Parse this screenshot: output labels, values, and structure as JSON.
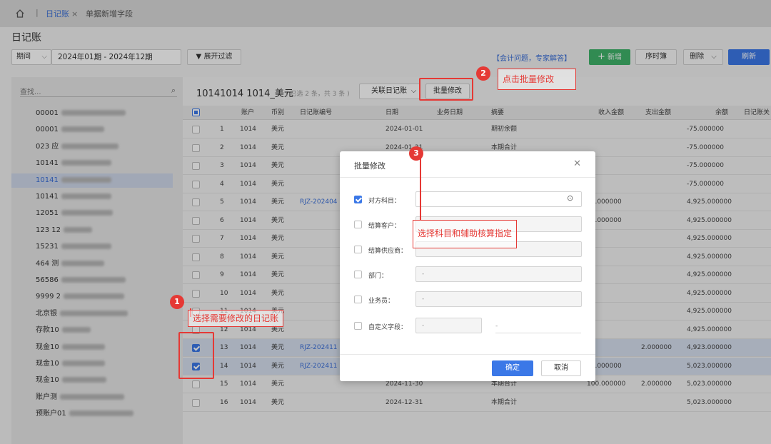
{
  "tabs": {
    "active": "日记账",
    "close": "×",
    "other": "单据新增字段"
  },
  "page_title": "日记账",
  "filter": {
    "period_label": "期间",
    "period_range": "2024年01期 - 2024年12期",
    "expand_filter": "展开过滤"
  },
  "toolbar": {
    "help_link": "【会计问题，专家解答】",
    "add": "新增",
    "sequence": "序时簿",
    "delete": "删除",
    "refresh": "刷新"
  },
  "sidebar": {
    "search_placeholder": "查找...",
    "items": [
      "00001",
      "00001",
      "023 应",
      "10141",
      "10141",
      "10141",
      "12051",
      "123 12",
      "15231",
      "464 测",
      "56586",
      "9999 2",
      "北京银",
      "存款10",
      "现金10",
      "现金10",
      "现金10",
      "账户测",
      "预账户01"
    ]
  },
  "account": {
    "title": "10141014 1014_美元",
    "selection_info": "( 已选 2 条，共 3 条 )",
    "related_journal": "关联日记账",
    "batch_edit": "批量修改"
  },
  "table": {
    "headers": [
      "账户",
      "币别",
      "日记账编号",
      "日期",
      "业务日期",
      "摘要",
      "收入金额",
      "支出金额",
      "余额",
      "日记账关"
    ],
    "rows": [
      {
        "n": "1",
        "acct": "1014",
        "cur": "美元",
        "no": "",
        "date": "2024-01-01",
        "bdate": "",
        "memo": "期初余额",
        "income": "",
        "expense": "",
        "balance": "-75.000000",
        "checked": false
      },
      {
        "n": "2",
        "acct": "1014",
        "cur": "美元",
        "no": "",
        "date": "2024-01-31",
        "bdate": "",
        "memo": "本期合计",
        "income": "",
        "expense": "",
        "balance": "-75.000000",
        "checked": false
      },
      {
        "n": "3",
        "acct": "1014",
        "cur": "美元",
        "no": "",
        "date": "",
        "bdate": "",
        "memo": "",
        "income": "",
        "expense": "",
        "balance": "-75.000000",
        "checked": false
      },
      {
        "n": "4",
        "acct": "1014",
        "cur": "美元",
        "no": "",
        "date": "",
        "bdate": "",
        "memo": "",
        "income": "",
        "expense": "",
        "balance": "-75.000000",
        "checked": false
      },
      {
        "n": "5",
        "acct": "1014",
        "cur": "美元",
        "no": "RJZ-202404",
        "date": "",
        "bdate": "",
        "memo": "",
        "income": "00.000000",
        "expense": "",
        "balance": "4,925.000000",
        "checked": false
      },
      {
        "n": "6",
        "acct": "1014",
        "cur": "美元",
        "no": "",
        "date": "",
        "bdate": "",
        "memo": "",
        "income": "00.000000",
        "expense": "",
        "balance": "4,925.000000",
        "checked": false
      },
      {
        "n": "7",
        "acct": "1014",
        "cur": "美元",
        "no": "",
        "date": "",
        "bdate": "",
        "memo": "",
        "income": "",
        "expense": "",
        "balance": "4,925.000000",
        "checked": false
      },
      {
        "n": "8",
        "acct": "1014",
        "cur": "美元",
        "no": "",
        "date": "",
        "bdate": "",
        "memo": "",
        "income": "",
        "expense": "",
        "balance": "4,925.000000",
        "checked": false
      },
      {
        "n": "9",
        "acct": "1014",
        "cur": "美元",
        "no": "",
        "date": "",
        "bdate": "",
        "memo": "",
        "income": "",
        "expense": "",
        "balance": "4,925.000000",
        "checked": false
      },
      {
        "n": "10",
        "acct": "1014",
        "cur": "美元",
        "no": "",
        "date": "",
        "bdate": "",
        "memo": "",
        "income": "",
        "expense": "",
        "balance": "4,925.000000",
        "checked": false
      },
      {
        "n": "11",
        "acct": "1014",
        "cur": "美元",
        "no": "",
        "date": "",
        "bdate": "",
        "memo": "",
        "income": "",
        "expense": "",
        "balance": "4,925.000000",
        "checked": false
      },
      {
        "n": "12",
        "acct": "1014",
        "cur": "美元",
        "no": "",
        "date": "",
        "bdate": "",
        "memo": "",
        "income": "",
        "expense": "",
        "balance": "4,925.000000",
        "checked": false
      },
      {
        "n": "13",
        "acct": "1014",
        "cur": "美元",
        "no": "RJZ-202411",
        "date": "",
        "bdate": "",
        "memo": "",
        "income": "",
        "expense": "2.000000",
        "balance": "4,923.000000",
        "checked": true
      },
      {
        "n": "14",
        "acct": "1014",
        "cur": "美元",
        "no": "RJZ-202411",
        "date": "",
        "bdate": "",
        "memo": "",
        "income": "00.000000",
        "expense": "",
        "balance": "5,023.000000",
        "checked": true
      },
      {
        "n": "15",
        "acct": "1014",
        "cur": "美元",
        "no": "",
        "date": "2024-11-30",
        "bdate": "",
        "memo": "本期合计",
        "income": "100.000000",
        "expense": "2.000000",
        "balance": "5,023.000000",
        "checked": false
      },
      {
        "n": "16",
        "acct": "1014",
        "cur": "美元",
        "no": "",
        "date": "2024-12-31",
        "bdate": "",
        "memo": "本期合计",
        "income": "",
        "expense": "",
        "balance": "5,023.000000",
        "checked": false
      }
    ]
  },
  "modal": {
    "title": "批量修改",
    "fields": [
      {
        "label": "对方科目：",
        "checked": true,
        "value": ""
      },
      {
        "label": "结算客户：",
        "checked": false,
        "value": ""
      },
      {
        "label": "结算供应商：",
        "checked": false,
        "value": ""
      },
      {
        "label": "部门：",
        "checked": false,
        "value": "-"
      },
      {
        "label": "业务员：",
        "checked": false,
        "value": "-"
      },
      {
        "label": "自定义字段：",
        "checked": false,
        "value": "-"
      }
    ],
    "confirm": "确定",
    "cancel": "取消"
  },
  "annotations": [
    {
      "num": "1",
      "text": "选择需要修改的日记账"
    },
    {
      "num": "2",
      "text": "点击批量修改"
    },
    {
      "num": "3",
      "text": "选择科目和辅助核算指定"
    }
  ],
  "colors": {
    "accent": "#3b78e7",
    "annotation": "#e53935",
    "green": "#3fb36a"
  }
}
